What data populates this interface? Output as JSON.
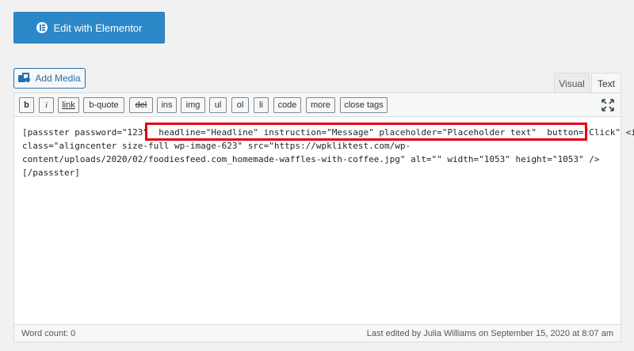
{
  "elementor": {
    "label": "Edit with Elementor",
    "icon": "elementor-icon"
  },
  "media": {
    "label": "Add Media",
    "icon": "media-icon"
  },
  "tabs": [
    {
      "label": "Visual",
      "active": false
    },
    {
      "label": "Text",
      "active": true
    }
  ],
  "toolbar": {
    "buttons": [
      "b",
      "i",
      "link",
      "b-quote",
      "del",
      "ins",
      "img",
      "ul",
      "ol",
      "li",
      "code",
      "more",
      "close tags"
    ],
    "fullscreen_icon": "fullscreen-icon"
  },
  "editor": {
    "line1_before": "[passster password=\"123\" ",
    "line1_highlight": " headline=\"Headline\" instruction=\"Message\" placeholder=\"Placeholder text\"  button=\"Click\"",
    "line1_after": " <img",
    "line2": "class=\"aligncenter size-full wp-image-623\" src=\"https://wpkliktest.com/wp-",
    "line3": "content/uploads/2020/02/foodiesfeed.com_homemade-waffles-with-coffee.jpg\" alt=\"\" width=\"1053\" height=\"1053\" />",
    "line4": "[/passster]"
  },
  "status": {
    "word_count": "Word count: 0",
    "last_edited": "Last edited by Julia Williams on September 15, 2020 at 8:07 am"
  },
  "colors": {
    "elementor_blue": "#2d88c9",
    "wp_blue": "#2271b1",
    "highlight_red": "#e3000f"
  }
}
